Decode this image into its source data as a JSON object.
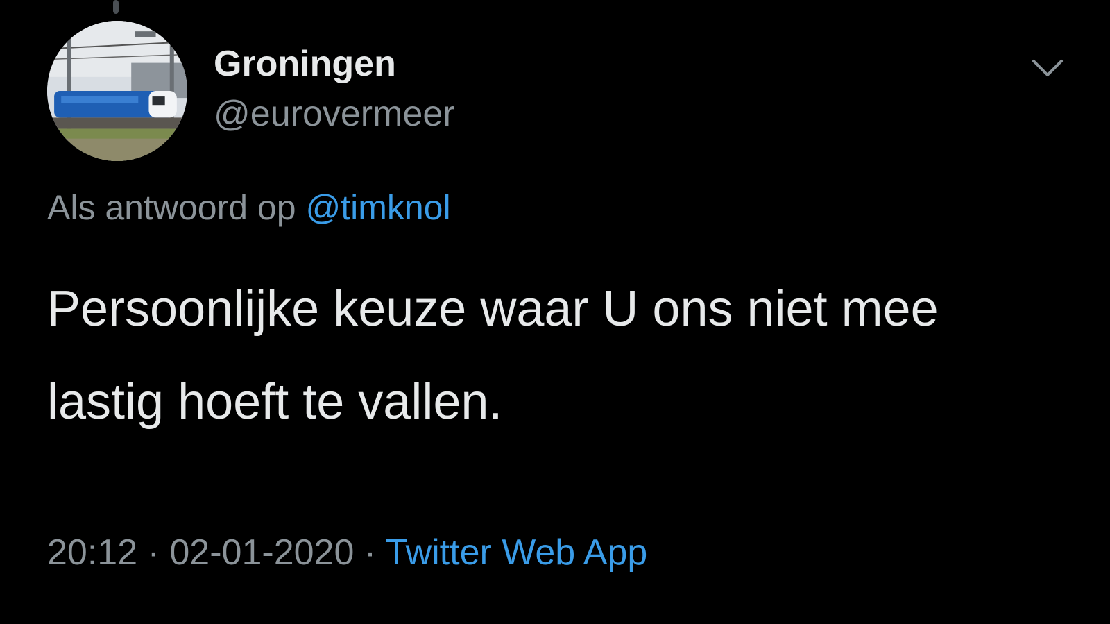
{
  "tweet": {
    "display_name": "Groningen",
    "handle": "@eurovermeer",
    "reply_prefix": "Als antwoord op",
    "reply_mention": "@timknol",
    "text": "Persoonlijke keuze waar U ons niet mee lastig hoeft te vallen.",
    "time": "20:12",
    "separator": "·",
    "date": "02-01-2020",
    "source": "Twitter Web App"
  },
  "icons": {
    "avatar": "avatar-train-photo",
    "menu": "chevron-down-icon"
  },
  "colors": {
    "background": "#000000",
    "primary_text": "#e7e9ea",
    "secondary_text": "#8b9399",
    "link": "#3a9ce8"
  }
}
